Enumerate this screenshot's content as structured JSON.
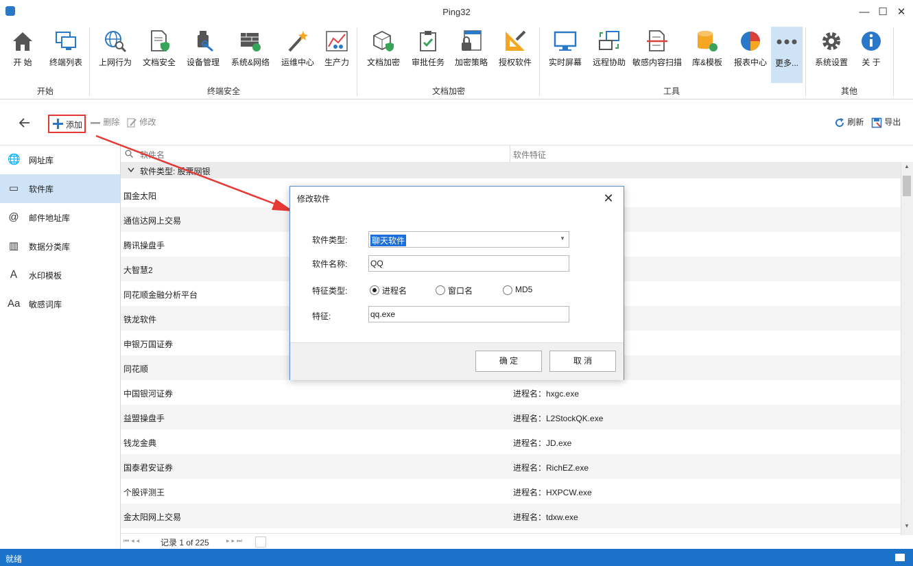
{
  "window": {
    "title": "Ping32",
    "minimize": "—",
    "maximize": "☐",
    "close": "✕"
  },
  "ribbon": {
    "groups": [
      {
        "label": "开始",
        "items": [
          {
            "label": "开 始",
            "icon": "home-icon"
          },
          {
            "label": "终端列表",
            "icon": "terminal-list-icon"
          }
        ]
      },
      {
        "label": "终端安全",
        "items": [
          {
            "label": "上网行为",
            "icon": "web-behavior-icon"
          },
          {
            "label": "文档安全",
            "icon": "document-security-icon"
          },
          {
            "label": "设备管理",
            "icon": "device-management-icon"
          },
          {
            "label": "系统&网络",
            "icon": "system-network-icon"
          },
          {
            "label": "运维中心",
            "icon": "ops-center-icon"
          },
          {
            "label": "生产力",
            "icon": "productivity-icon"
          }
        ]
      },
      {
        "label": "文档加密",
        "items": [
          {
            "label": "文档加密",
            "icon": "document-encrypt-icon"
          },
          {
            "label": "审批任务",
            "icon": "approval-task-icon"
          },
          {
            "label": "加密策略",
            "icon": "encrypt-policy-icon"
          },
          {
            "label": "授权软件",
            "icon": "authorized-software-icon"
          }
        ]
      },
      {
        "label": "工具",
        "items": [
          {
            "label": "实时屏幕",
            "icon": "realtime-screen-icon"
          },
          {
            "label": "远程协助",
            "icon": "remote-assist-icon"
          },
          {
            "label": "敏感内容扫描",
            "icon": "sensitive-scan-icon"
          },
          {
            "label": "库&模板",
            "icon": "library-template-icon"
          },
          {
            "label": "报表中心",
            "icon": "report-center-icon"
          },
          {
            "label": "更多...",
            "icon": "more-icon"
          }
        ]
      },
      {
        "label": "其他",
        "items": [
          {
            "label": "系统设置",
            "icon": "settings-gear-icon"
          },
          {
            "label": "关 于",
            "icon": "about-info-icon"
          }
        ]
      }
    ]
  },
  "toolbar": {
    "add": "添加",
    "delete": "删除",
    "edit": "修改",
    "refresh": "刷新",
    "export": "导出"
  },
  "sidebar": {
    "items": [
      {
        "label": "网址库",
        "icon": "globe-icon",
        "glyph": "🌐"
      },
      {
        "label": "软件库",
        "icon": "window-icon",
        "glyph": "▭"
      },
      {
        "label": "邮件地址库",
        "icon": "at-sign-icon",
        "glyph": "@"
      },
      {
        "label": "数据分类库",
        "icon": "data-category-icon",
        "glyph": "▥"
      },
      {
        "label": "水印模板",
        "icon": "watermark-icon",
        "glyph": "Ａ"
      },
      {
        "label": "敏感词库",
        "icon": "font-aa-icon",
        "glyph": "Aa"
      }
    ]
  },
  "grid": {
    "columns": [
      "软件名",
      "软件特征"
    ],
    "group_label": "软件类型: 股票网银",
    "rows": [
      {
        "name": "国金太阳",
        "feature": ""
      },
      {
        "name": "通信达网上交易",
        "feature": ""
      },
      {
        "name": "腾讯操盘手",
        "feature": ""
      },
      {
        "name": "大智慧2",
        "feature": ""
      },
      {
        "name": "同花顺金融分析平台",
        "feature": ""
      },
      {
        "name": "铁龙软件",
        "feature": ""
      },
      {
        "name": "申银万国证券",
        "feature": ""
      },
      {
        "name": "同花顺",
        "feature": ""
      },
      {
        "name": "中国银河证券",
        "feature": "进程名：hxgc.exe"
      },
      {
        "name": "益盟操盘手",
        "feature": "进程名：L2StockQK.exe"
      },
      {
        "name": "钱龙金典",
        "feature": "进程名：JD.exe"
      },
      {
        "name": "国泰君安证券",
        "feature": "进程名：RichEZ.exe"
      },
      {
        "name": "个股评测王",
        "feature": "进程名：HXPCW.exe"
      },
      {
        "name": "金太阳网上交易",
        "feature": "进程名：tdxw.exe"
      }
    ],
    "pager_text": "记录 1 of 225"
  },
  "status": {
    "text": "就绪"
  },
  "dialog": {
    "title": "修改软件",
    "type_label": "软件类型:",
    "type_value": "聊天软件",
    "name_label": "软件名称:",
    "name_value": "QQ",
    "feature_type_label": "特征类型:",
    "radio_options": [
      "进程名",
      "窗口名",
      "MD5"
    ],
    "selected_radio": "进程名",
    "feature_label": "特征:",
    "feature_value": "qq.exe",
    "ok": "确 定",
    "cancel": "取 消"
  },
  "colors": {
    "accent": "#1a73c8",
    "highlight": "#cfe3f6",
    "annotation": "#e53935"
  }
}
